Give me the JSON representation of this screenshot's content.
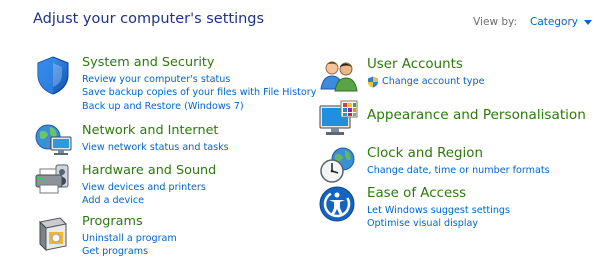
{
  "header": {
    "title": "Adjust your computer's settings",
    "view_by_label": "View by:",
    "view_by_value": "Category"
  },
  "categories": {
    "system": {
      "title": "System and Security",
      "links": [
        "Review your computer's status",
        "Save backup copies of your files with File History",
        "Back up and Restore (Windows 7)"
      ]
    },
    "network": {
      "title": "Network and Internet",
      "links": [
        "View network status and tasks"
      ]
    },
    "hardware": {
      "title": "Hardware and Sound",
      "links": [
        "View devices and printers",
        "Add a device"
      ]
    },
    "programs": {
      "title": "Programs",
      "links": [
        "Uninstall a program",
        "Get programs"
      ]
    },
    "user": {
      "title": "User Accounts",
      "links": [
        "Change account type"
      ]
    },
    "appearance": {
      "title": "Appearance and Personalisation",
      "links": []
    },
    "clock": {
      "title": "Clock and Region",
      "links": [
        "Change date, time or number formats"
      ]
    },
    "ease": {
      "title": "Ease of Access",
      "links": [
        "Let Windows suggest settings",
        "Optimise visual display"
      ]
    }
  },
  "icons": {
    "system": "shield-icon",
    "network": "globe-network-icon",
    "hardware": "printer-speaker-icon",
    "programs": "programs-box-icon",
    "user": "users-icon",
    "appearance": "monitor-palette-icon",
    "clock": "clock-globe-icon",
    "ease": "ease-of-access-icon",
    "uac": "uac-shield-icon"
  },
  "colors": {
    "title_blue": "#1e3287",
    "category_green": "#2b7a0b",
    "link_blue": "#0066cc",
    "muted": "#6d6d6d"
  }
}
